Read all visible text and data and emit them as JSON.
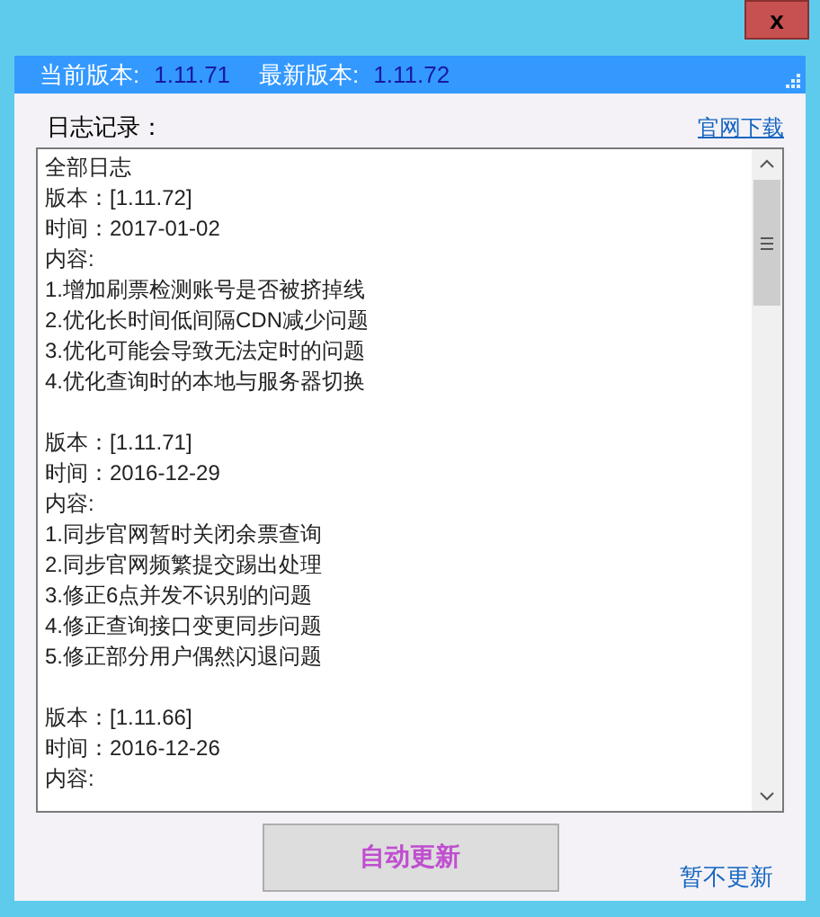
{
  "window": {
    "close": "x"
  },
  "version_bar": {
    "current_label": "当前版本:",
    "current": "1.11.71",
    "latest_label": "最新版本:",
    "latest": "1.11.72"
  },
  "log": {
    "label": "日志记录：",
    "download_link": "官网下载",
    "header": "全部日志",
    "entries": [
      {
        "lines": [
          "版本：[1.11.72]",
          "时间：2017-01-02",
          "内容:",
          "1.增加刷票检测账号是否被挤掉线",
          "2.优化长时间低间隔CDN减少问题",
          "3.优化可能会导致无法定时的问题",
          "4.优化查询时的本地与服务器切换"
        ]
      },
      {
        "lines": [
          "版本：[1.11.71]",
          "时间：2016-12-29",
          "内容:",
          "1.同步官网暂时关闭余票查询",
          "2.同步官网频繁提交踢出处理",
          "3.修正6点并发不识别的问题",
          "4.修正查询接口变更同步问题",
          "5.修正部分用户偶然闪退问题"
        ]
      },
      {
        "lines": [
          "版本：[1.11.66]",
          "时间：2016-12-26",
          "内容:"
        ]
      }
    ]
  },
  "buttons": {
    "auto_update": "自动更新",
    "skip": "暂不更新"
  }
}
